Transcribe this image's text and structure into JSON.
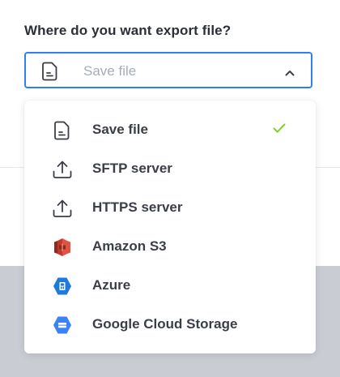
{
  "question": "Where do you want export file?",
  "select": {
    "value": "Save file",
    "icon": "file-icon",
    "state": "open"
  },
  "options": [
    {
      "label": "Save file",
      "icon": "file-icon",
      "selected": true
    },
    {
      "label": "SFTP server",
      "icon": "upload-icon",
      "selected": false
    },
    {
      "label": "HTTPS server",
      "icon": "upload-icon",
      "selected": false
    },
    {
      "label": "Amazon S3",
      "icon": "amazon-s3-icon",
      "selected": false
    },
    {
      "label": "Azure",
      "icon": "azure-icon",
      "selected": false
    },
    {
      "label": "Google Cloud Storage",
      "icon": "google-cloud-storage-icon",
      "selected": false
    }
  ],
  "colors": {
    "accent": "#2f80ed",
    "check": "#7ed321",
    "amazon": "#d9412e",
    "azure": "#1f7bd8",
    "gcs": "#3b82f6"
  }
}
